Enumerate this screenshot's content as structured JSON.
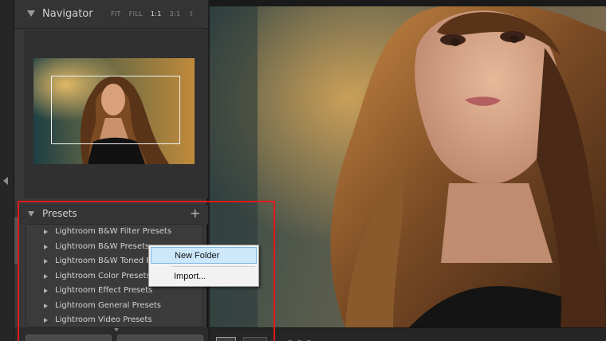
{
  "navigator": {
    "title": "Navigator",
    "zoom_options": [
      "FIT",
      "FILL",
      "1:1",
      "3:1"
    ],
    "active_zoom": "1:1"
  },
  "presets": {
    "title": "Presets",
    "add_icon": "plus-icon",
    "items": [
      {
        "label": "Lightroom B&W Filter Presets"
      },
      {
        "label": "Lightroom B&W Presets"
      },
      {
        "label": "Lightroom B&W Toned P"
      },
      {
        "label": "Lightroom Color Presets"
      },
      {
        "label": "Lightroom Effect Presets"
      },
      {
        "label": "Lightroom General Presets"
      },
      {
        "label": "Lightroom Video Presets"
      }
    ]
  },
  "context_menu": {
    "items": [
      {
        "label": "New Folder",
        "highlighted": true
      },
      {
        "label": "Import..."
      }
    ]
  },
  "colors": {
    "panel_bg": "#383838",
    "highlight_border": "#e11919",
    "menu_hover": "#cde7fb"
  }
}
